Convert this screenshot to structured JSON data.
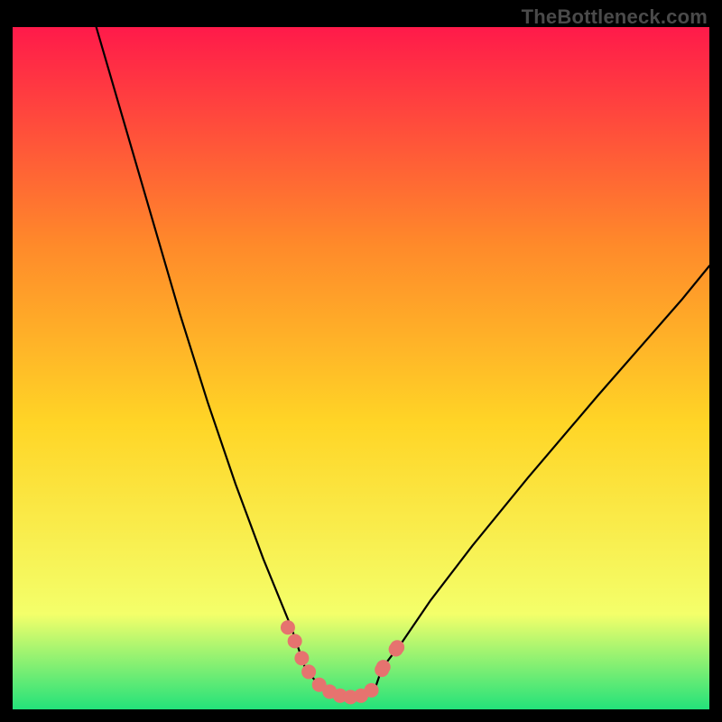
{
  "watermark": "TheBottleneck.com",
  "colors": {
    "gradient_top": "#ff1a4a",
    "gradient_upper_mid": "#ff8a2a",
    "gradient_mid": "#ffd526",
    "gradient_lower_mid": "#f4ff6a",
    "gradient_bottom": "#23e27a",
    "curve_stroke": "#000000",
    "marker_fill": "#e6736f",
    "frame": "#000000"
  },
  "chart_data": {
    "type": "line",
    "title": "",
    "xlabel": "",
    "ylabel": "",
    "xlim": [
      0,
      100
    ],
    "ylim": [
      0,
      100
    ],
    "series": [
      {
        "name": "left-branch",
        "x": [
          12,
          16,
          20,
          24,
          28,
          32,
          36,
          40,
          42
        ],
        "values": [
          100,
          86,
          72,
          58,
          45,
          33,
          22,
          12,
          6
        ]
      },
      {
        "name": "right-branch",
        "x": [
          53,
          56,
          60,
          66,
          74,
          84,
          96,
          100
        ],
        "values": [
          6,
          10,
          16,
          24,
          34,
          46,
          60,
          65
        ]
      },
      {
        "name": "valley-floor",
        "x": [
          42,
          44,
          46,
          48,
          50,
          52,
          53
        ],
        "values": [
          6,
          3.5,
          2.2,
          1.8,
          2.0,
          3.0,
          6
        ]
      }
    ],
    "markers": [
      {
        "x": 39.5,
        "y": 12.0
      },
      {
        "x": 40.5,
        "y": 10.0
      },
      {
        "x": 41.5,
        "y": 7.5
      },
      {
        "x": 42.5,
        "y": 5.5
      },
      {
        "x": 44.0,
        "y": 3.6
      },
      {
        "x": 45.5,
        "y": 2.6
      },
      {
        "x": 47.0,
        "y": 2.0
      },
      {
        "x": 48.5,
        "y": 1.8
      },
      {
        "x": 50.0,
        "y": 2.0
      },
      {
        "x": 51.5,
        "y": 2.8
      },
      {
        "x": 53.0,
        "y": 5.8
      },
      {
        "x": 53.2,
        "y": 6.2
      },
      {
        "x": 55.0,
        "y": 8.8
      },
      {
        "x": 55.2,
        "y": 9.1
      }
    ],
    "annotations": [],
    "legend": false,
    "grid": false
  }
}
